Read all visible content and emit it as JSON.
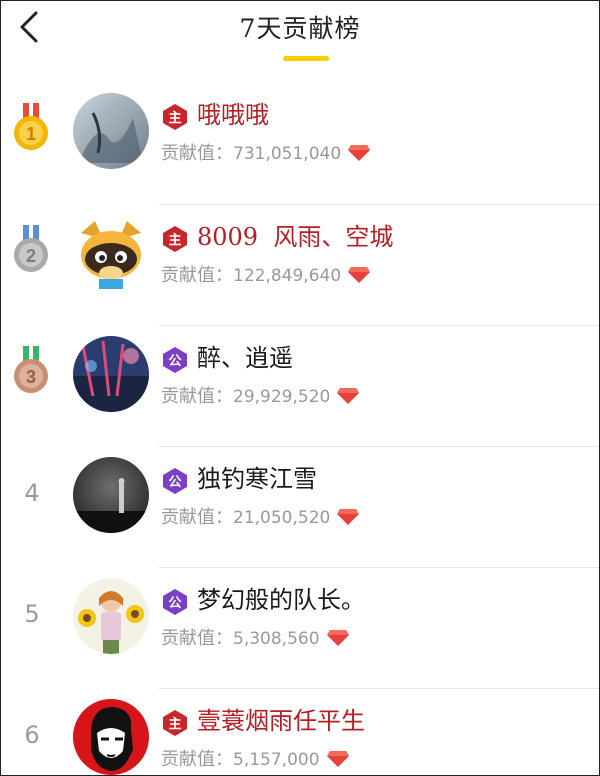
{
  "header": {
    "title": "7天贡献榜"
  },
  "contrib_label": "贡献值：",
  "rows": [
    {
      "rank": "1",
      "name": "哦哦哦",
      "value": "731,051,040",
      "badge": "主",
      "badge_color": "#c8262b",
      "name_color": "red"
    },
    {
      "rank": "2",
      "name": "8009  风雨、空城",
      "value": "122,849,640",
      "badge": "主",
      "badge_color": "#c8262b",
      "name_color": "red"
    },
    {
      "rank": "3",
      "name": "醉、逍遥",
      "value": "29,929,520",
      "badge": "公",
      "badge_color": "#7a3fc6",
      "name_color": "black"
    },
    {
      "rank": "4",
      "name": "独钓寒江雪",
      "value": "21,050,520",
      "badge": "公",
      "badge_color": "#7a3fc6",
      "name_color": "black"
    },
    {
      "rank": "5",
      "name": "梦幻般的队长。",
      "value": "5,308,560",
      "badge": "公",
      "badge_color": "#7a3fc6",
      "name_color": "black"
    },
    {
      "rank": "6",
      "name": "壹蓑烟雨任平生",
      "value": "5,157,000",
      "badge": "主",
      "badge_color": "#c8262b",
      "name_color": "red"
    }
  ],
  "medal_colors": {
    "gold": "#f2b705",
    "silver": "#a9a9a9",
    "bronze": "#c98f72"
  },
  "gem_color": "#e8403c"
}
